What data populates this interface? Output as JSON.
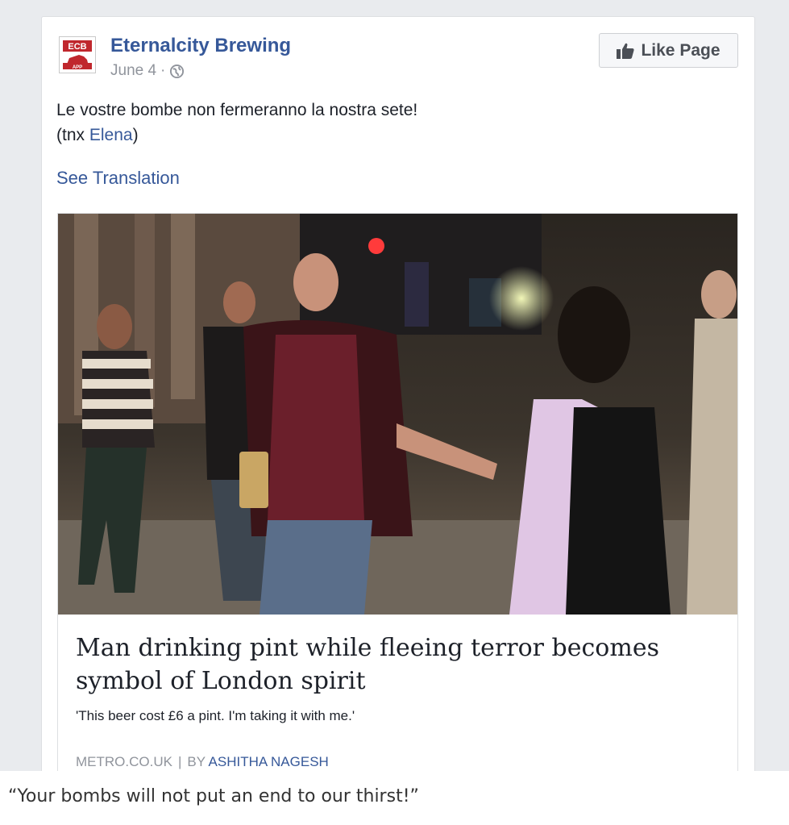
{
  "post": {
    "logo_text_top": "ECB",
    "logo_text_bottom": "APP",
    "page_name": "Eternalcity Brewing",
    "date": "June 4",
    "separator": "·",
    "privacy_icon": "globe-icon",
    "like_button_label": "Like Page",
    "like_button_icon": "thumbs-up-icon",
    "text_line1": "Le vostre bombe non fermeranno la nostra sete!",
    "text_line2_prefix": "(tnx ",
    "text_line2_mention": "Elena",
    "text_line2_suffix": ")",
    "see_translation": "See Translation"
  },
  "link_preview": {
    "headline": "Man drinking pint while fleeing terror becomes symbol of London spirit",
    "subtitle": "'This beer cost £6 a pint. I'm taking it with me.'",
    "source": "METRO.CO.UK",
    "divider": "|",
    "by_prefix": "BY",
    "author": "ASHITHA NAGESH"
  },
  "caption": "“Your bombs will not put an end to our thirst!”",
  "colors": {
    "link_blue": "#365899",
    "background_gray": "#e9ebee",
    "logo_red": "#c0272d"
  }
}
